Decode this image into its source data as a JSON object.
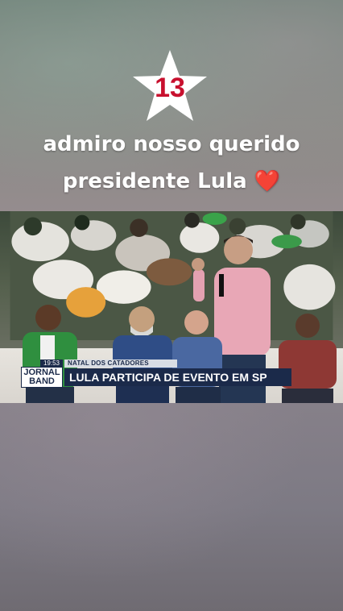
{
  "overlay": {
    "star_number": "13",
    "line1": "admiro nosso querido",
    "line2": "presidente Lula",
    "heart": "❤️"
  },
  "video": {
    "logo_line1": "JORNAL",
    "logo_line2": "BAND",
    "time": "19:53",
    "kicker": "NATAL DOS CATADORES",
    "headline": "LULA PARTICIPA DE EVENTO EM SP"
  },
  "colors": {
    "star_number": "#c8102e",
    "heart": "#e0202e",
    "tv_navy": "#1b2a4a"
  }
}
